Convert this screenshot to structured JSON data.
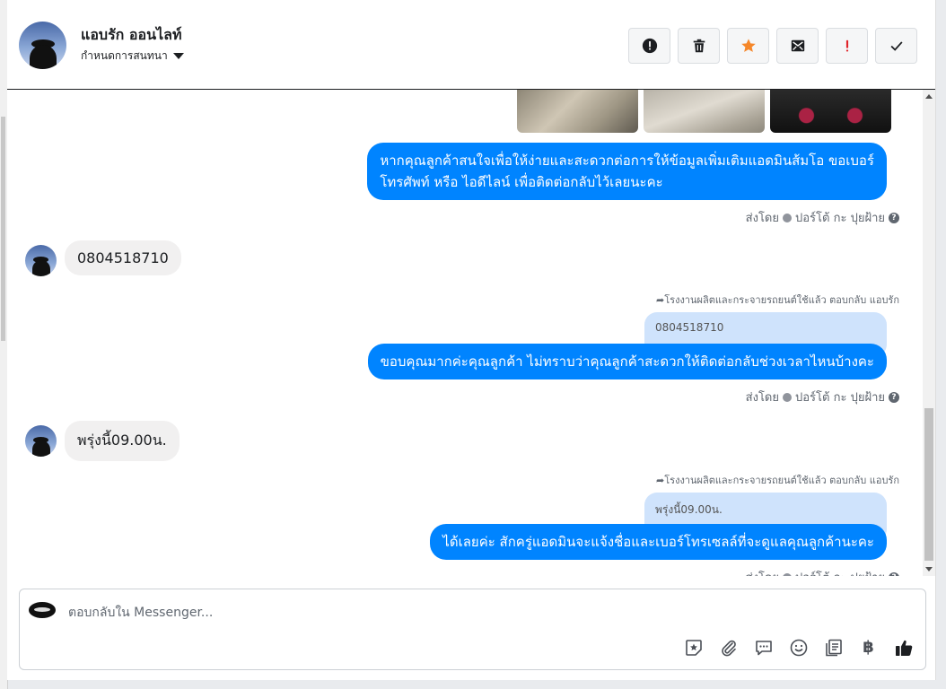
{
  "header": {
    "contact_name": "แอบรัก ออนไลท์",
    "assign_label": "กำหนดการสนทนา",
    "actions": [
      {
        "icon": "alert-circle-icon"
      },
      {
        "icon": "trash-icon"
      },
      {
        "icon": "star-icon"
      },
      {
        "icon": "mail-icon"
      },
      {
        "icon": "exclamation-icon"
      },
      {
        "icon": "check-icon"
      }
    ]
  },
  "messages": [
    {
      "type": "outgoing",
      "text_line1": "หากคุณลูกค้าสนใจเพื่อให้ง่ายและสะดวกต่อการให้ข้อมูลเพิ่มเติมแอดมินส้มโอ ขอเบอร์",
      "text_line2": "โทรศัพท์ หรือ ไอดีไลน์ เพื่อติดต่อกลับไว้เลยนะคะ",
      "sent_by_prefix": "ส่งโดย",
      "sent_by_name": "ปอร์โต้ กะ ปุยฝ้าย"
    },
    {
      "type": "incoming",
      "text": "0804518710"
    },
    {
      "type": "outgoing",
      "reply_note": "โรงงานผลิตและกระจายรถยนต์ใช้แล้ว ตอบกลับ แอบรัก",
      "quoted": "0804518710",
      "text": "ขอบคุณมากค่ะคุณลูกค้า ไม่ทราบว่าคุณลูกค้าสะดวกให้ติดต่อกลับช่วงเวลาไหนบ้างคะ",
      "sent_by_prefix": "ส่งโดย",
      "sent_by_name": "ปอร์โต้ กะ ปุยฝ้าย"
    },
    {
      "type": "incoming",
      "text": "พรุ่งนี้09.00น."
    },
    {
      "type": "outgoing",
      "reply_note": "โรงงานผลิตและกระจายรถยนต์ใช้แล้ว ตอบกลับ แอบรัก",
      "quoted": "พรุ่งนี้09.00น.",
      "text": "ได้เลยค่ะ สักครู่แอดมินจะแจ้งชื่อและเบอร์โทรเซลล์ที่จะดูแลคุณลูกค้านะคะ",
      "sent_by_prefix": "ส่งโดย",
      "sent_by_name": "ปอร์โต้ กะ ปุยฝ้าย"
    }
  ],
  "composer": {
    "placeholder": "ตอบกลับใน Messenger...",
    "tools": [
      "sticker-star-icon",
      "attachment-icon",
      "saved-reply-icon",
      "emoji-icon",
      "catalog-icon",
      "baht-icon",
      "like-icon"
    ],
    "currency_symbol": "฿"
  },
  "colors": {
    "outgoing_bubble": "#0084ff",
    "incoming_bubble": "#f1f0f0",
    "quote_bubble": "#cfe3fc",
    "star": "#f5872a",
    "alert_red": "#e0242a"
  }
}
